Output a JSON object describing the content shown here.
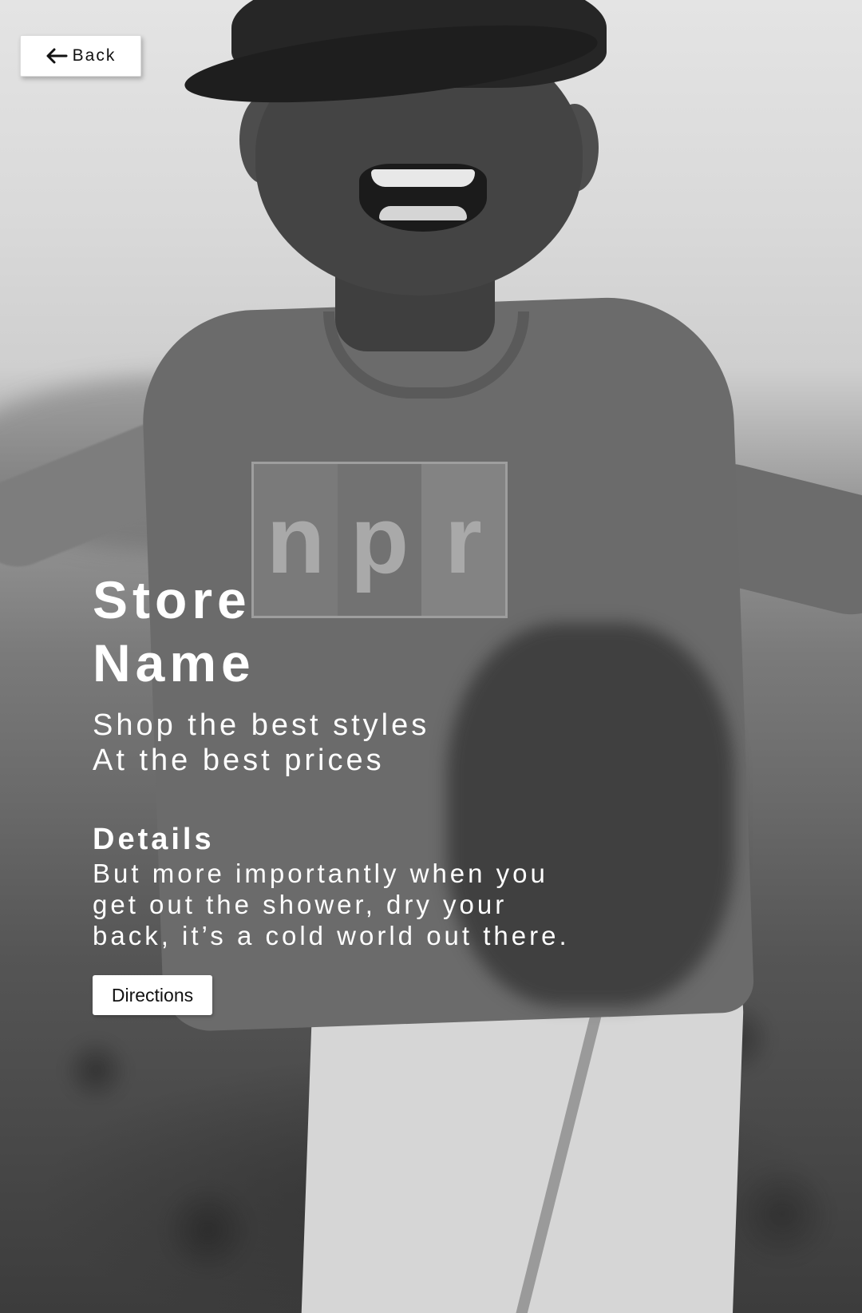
{
  "navigation": {
    "back_label": "Back",
    "back_icon": "arrow-left-icon"
  },
  "store": {
    "name": "Store Name",
    "tagline": [
      "Shop the best styles",
      "At the best prices"
    ]
  },
  "details": {
    "heading": "Details",
    "body": "But more importantly when you get out the shower, dry your back, it’s a cold world out there."
  },
  "actions": {
    "directions_label": "Directions"
  },
  "hero_image": {
    "shirt_logo": [
      "n",
      "p",
      "r"
    ]
  },
  "colors": {
    "text": "#ffffff",
    "button_bg": "#ffffff",
    "button_text": "#111111"
  }
}
